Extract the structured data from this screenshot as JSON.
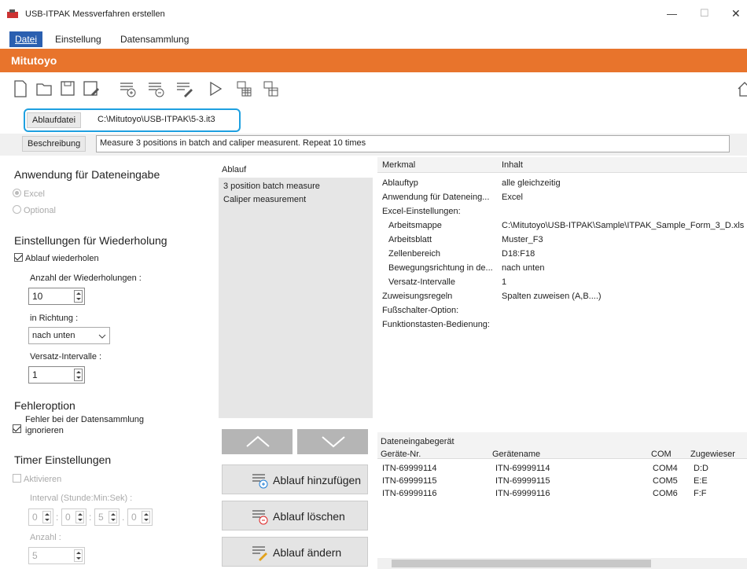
{
  "window": {
    "title": "USB-ITPAK Messverfahren erstellen",
    "controls": {
      "minimize": "—",
      "maximize": "☐",
      "close": "✕"
    }
  },
  "menu": {
    "items": [
      "Datei",
      "Einstellung",
      "Datensammlung"
    ]
  },
  "brand": {
    "name": "Mitutoyo",
    "color": "#e8742c"
  },
  "toolbar": {
    "icons": [
      "new-file-icon",
      "open-folder-icon",
      "save-icon",
      "save-as-icon",
      "add-flow-icon",
      "remove-flow-icon",
      "edit-flow-icon",
      "run-icon",
      "spreadsheet-icon",
      "spreadsheet-link-icon",
      "home-icon"
    ]
  },
  "file": {
    "label": "Ablaufdatei",
    "path": "C:\\Mitutoyo\\USB-ITPAK\\5-3.it3"
  },
  "description": {
    "label": "Beschreibung",
    "value": "Measure 3 positions in batch and caliper measurent. Repeat 10 times"
  },
  "left": {
    "app_title": "Anwendung für Dateneingabe",
    "radio_excel": "Excel",
    "radio_optional": "Optional",
    "repeat_title": "Einstellungen für Wiederholung",
    "repeat_check": "Ablauf wiederholen",
    "repeat_count_label": "Anzahl der Wiederholungen :",
    "repeat_count_value": "10",
    "direction_label": "in Richtung :",
    "direction_value": "nach unten",
    "offset_label": "Versatz-Intervalle :",
    "offset_value": "1",
    "error_title": "Fehleroption",
    "error_check_line1": "Fehler bei der Datensammlung",
    "error_check_line2": "ignorieren",
    "timer_title": "Timer Einstellungen",
    "timer_check": "Aktivieren",
    "interval_label": "Interval (Stunde:Min:Sek) :",
    "interval_values": [
      "0",
      "0",
      "5",
      "0"
    ],
    "interval_separators": [
      ":",
      ":",
      "."
    ],
    "count_label": "Anzahl :",
    "count_value": "5"
  },
  "flow": {
    "header": "Ablauf",
    "items": [
      "3 position batch measure",
      "Caliper measurement"
    ],
    "add_label": "Ablauf hinzufügen",
    "delete_label": "Ablauf löschen",
    "edit_label": "Ablauf ändern"
  },
  "props": {
    "col_key": "Merkmal",
    "col_value": "Inhalt",
    "rows": [
      {
        "k": "Ablauftyp",
        "v": "alle gleichzeitig"
      },
      {
        "k": "Anwendung für Dateneing...",
        "v": "Excel"
      },
      {
        "k": "Excel-Einstellungen:",
        "v": ""
      },
      {
        "k": "Arbeitsmappe",
        "v": "C:\\Mitutoyo\\USB-ITPAK\\Sample\\ITPAK_Sample_Form_3_D.xls"
      },
      {
        "k": "Arbeitsblatt",
        "v": "Muster_F3"
      },
      {
        "k": "Zellenbereich",
        "v": "D18:F18"
      },
      {
        "k": "Bewegungsrichtung in de...",
        "v": "nach unten"
      },
      {
        "k": "Versatz-Intervalle",
        "v": "1"
      },
      {
        "k": "Zuweisungsregeln",
        "v": "Spalten zuweisen (A,B....)"
      },
      {
        "k": "Fußschalter-Option:",
        "v": ""
      },
      {
        "k": "Funktionstasten-Bedienung:",
        "v": ""
      }
    ]
  },
  "devices": {
    "group": "Dateneingabegerät",
    "col_no": "Geräte-Nr.",
    "col_name": "Gerätename",
    "col_com": "COM",
    "col_assign": "Zugewieser",
    "rows": [
      {
        "no": "ITN-69999114",
        "name": "ITN-69999114",
        "com": "COM4",
        "assign": "D:D"
      },
      {
        "no": "ITN-69999115",
        "name": "ITN-69999115",
        "com": "COM5",
        "assign": "E:E"
      },
      {
        "no": "ITN-69999116",
        "name": "ITN-69999116",
        "com": "COM6",
        "assign": "F:F"
      }
    ]
  }
}
